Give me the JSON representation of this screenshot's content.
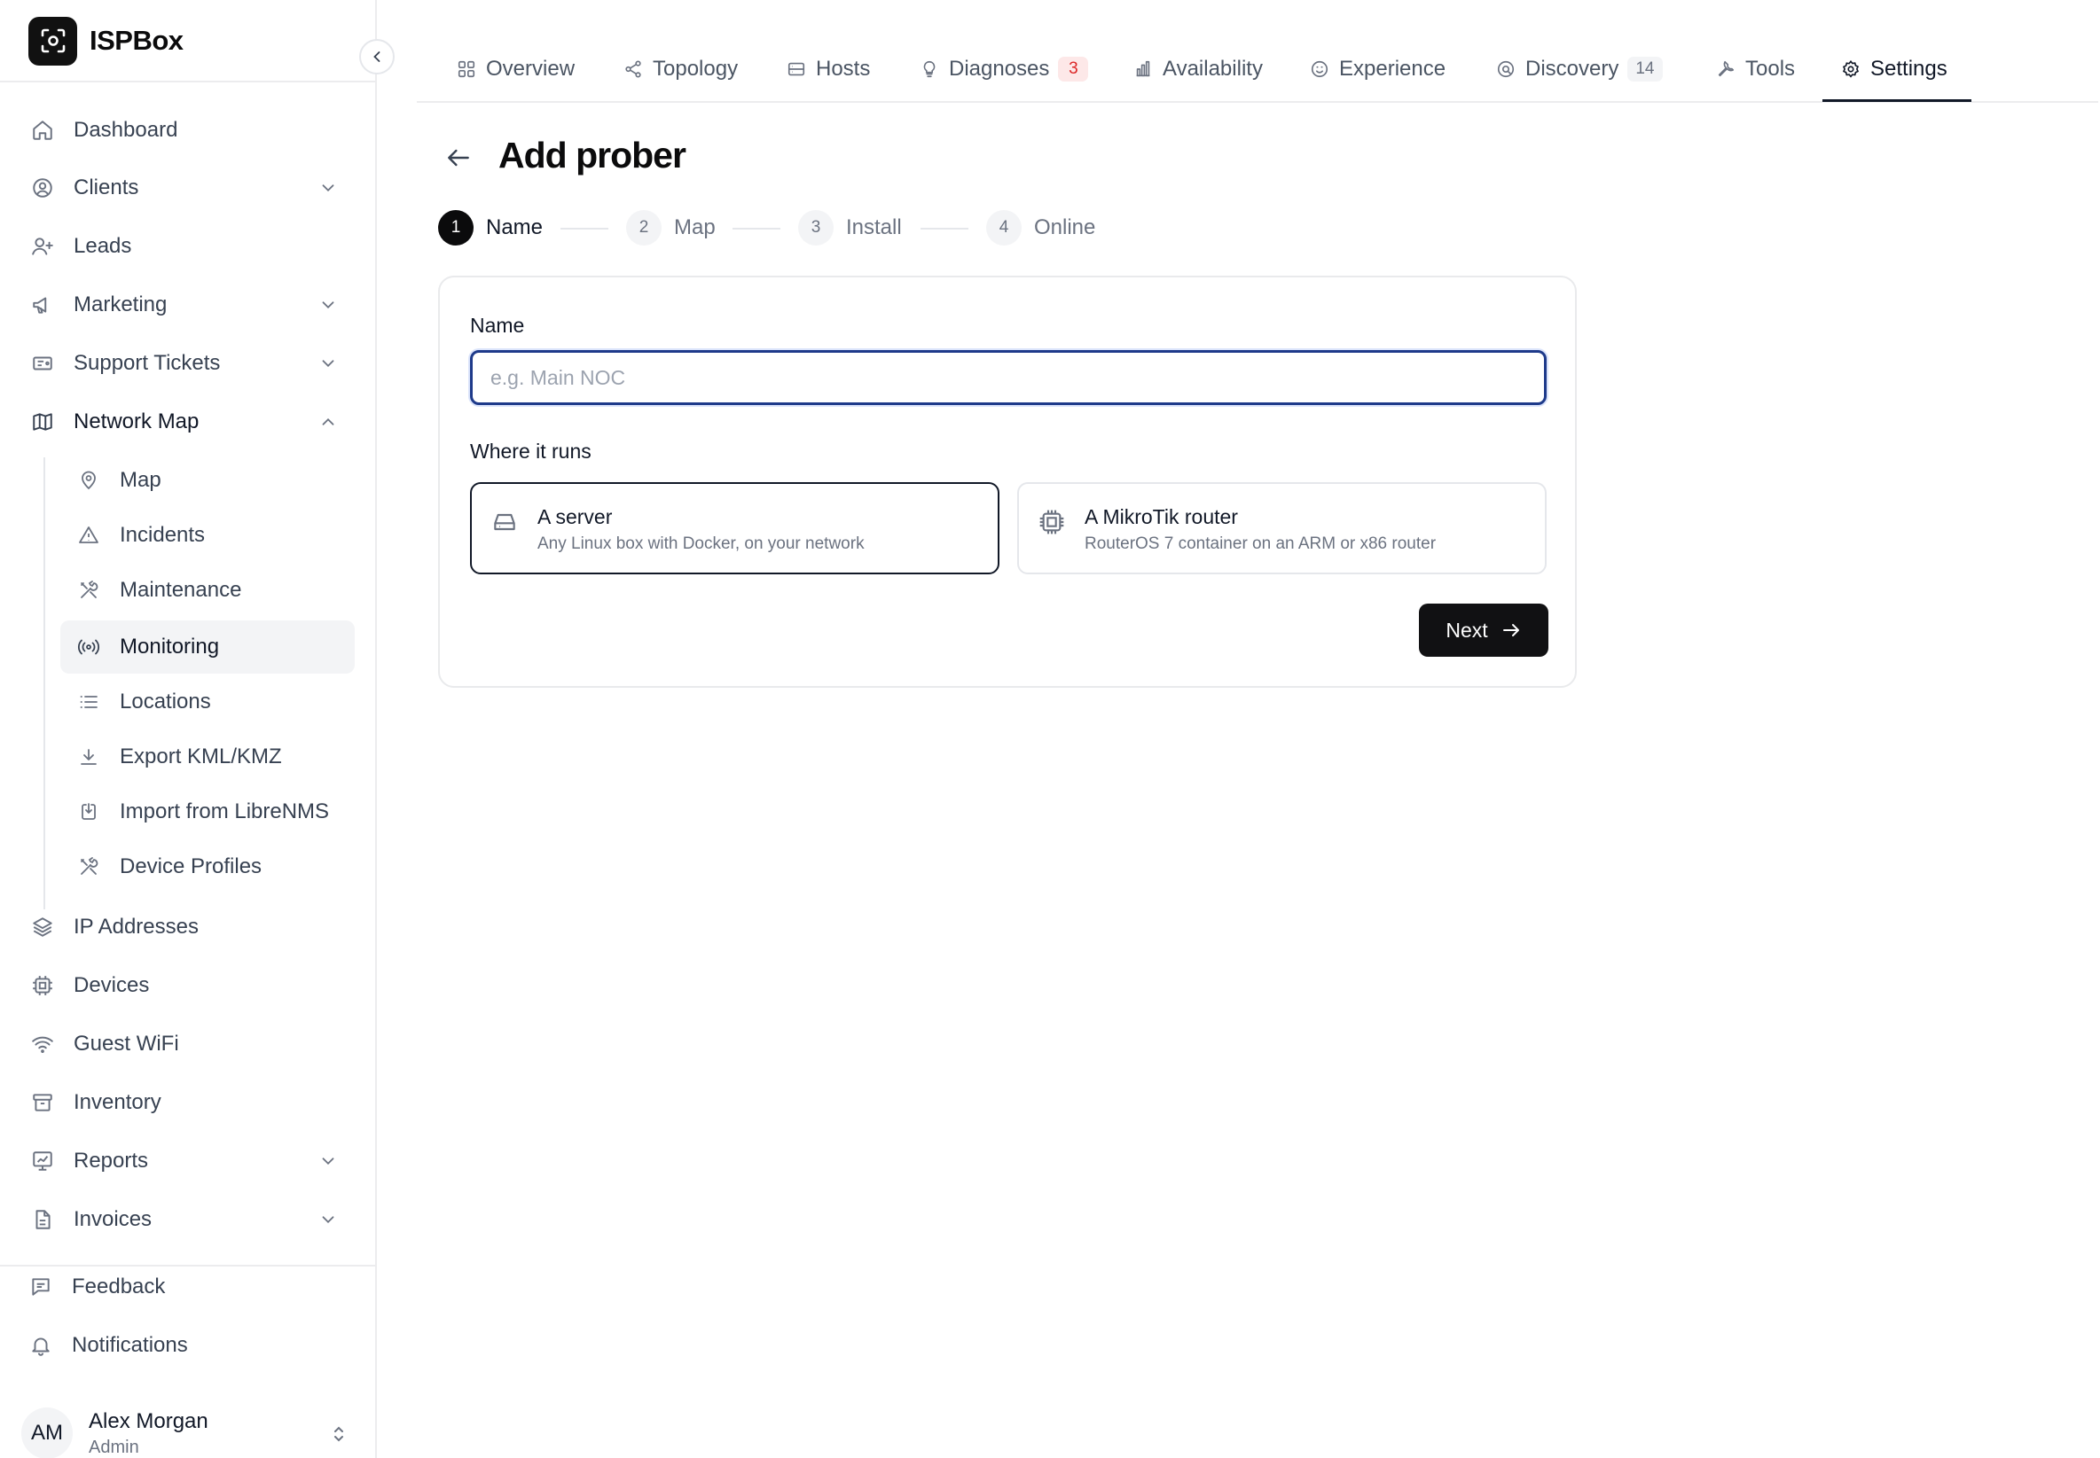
{
  "app": {
    "name": "ISPBox"
  },
  "sidebar": {
    "items": [
      {
        "label": "Dashboard",
        "icon": "home-icon"
      },
      {
        "label": "Clients",
        "icon": "user-circle-icon",
        "expandable": true,
        "expanded": false
      },
      {
        "label": "Leads",
        "icon": "user-plus-icon"
      },
      {
        "label": "Marketing",
        "icon": "megaphone-icon",
        "expandable": true,
        "expanded": false
      },
      {
        "label": "Support Tickets",
        "icon": "ticket-icon",
        "expandable": true,
        "expanded": false
      },
      {
        "label": "Network Map",
        "icon": "map-icon",
        "expandable": true,
        "expanded": true
      }
    ],
    "subitems": [
      {
        "label": "Map",
        "icon": "map-pin-icon"
      },
      {
        "label": "Incidents",
        "icon": "warning-triangle-icon"
      },
      {
        "label": "Maintenance",
        "icon": "tools-icon"
      },
      {
        "label": "Monitoring",
        "icon": "radio-signal-icon",
        "active": true
      },
      {
        "label": "Locations",
        "icon": "list-icon"
      },
      {
        "label": "Export KML/KMZ",
        "icon": "download-icon"
      },
      {
        "label": "Import from LibreNMS",
        "icon": "import-icon"
      },
      {
        "label": "Device Profiles",
        "icon": "tools-icon"
      }
    ],
    "items_after": [
      {
        "label": "IP Addresses",
        "icon": "layers-icon"
      },
      {
        "label": "Devices",
        "icon": "chip-icon"
      },
      {
        "label": "Guest WiFi",
        "icon": "wifi-icon"
      },
      {
        "label": "Inventory",
        "icon": "archive-icon"
      },
      {
        "label": "Reports",
        "icon": "chart-icon",
        "expandable": true,
        "expanded": false
      },
      {
        "label": "Invoices",
        "icon": "file-icon",
        "expandable": true,
        "expanded": false
      }
    ],
    "footer": [
      {
        "label": "Feedback",
        "icon": "message-icon"
      },
      {
        "label": "Notifications",
        "icon": "bell-icon"
      }
    ],
    "user": {
      "initials": "AM",
      "name": "Alex Morgan",
      "role": "Admin"
    }
  },
  "tabs": [
    {
      "label": "Overview",
      "icon": "grid-icon"
    },
    {
      "label": "Topology",
      "icon": "share-icon"
    },
    {
      "label": "Hosts",
      "icon": "server-icon"
    },
    {
      "label": "Diagnoses",
      "icon": "lightbulb-icon",
      "badge": "3",
      "badge_color": "#dc2626"
    },
    {
      "label": "Availability",
      "icon": "bar-chart-icon"
    },
    {
      "label": "Experience",
      "icon": "smile-icon"
    },
    {
      "label": "Discovery",
      "icon": "scan-icon",
      "badge": "14",
      "badge_color": "#6b7280"
    },
    {
      "label": "Tools",
      "icon": "wrench-icon"
    },
    {
      "label": "Settings",
      "icon": "gear-icon",
      "active": true
    }
  ],
  "page": {
    "title": "Add prober"
  },
  "stepper": [
    {
      "number": "1",
      "label": "Name",
      "state": "current"
    },
    {
      "number": "2",
      "label": "Map",
      "state": "todo"
    },
    {
      "number": "3",
      "label": "Install",
      "state": "todo"
    },
    {
      "number": "4",
      "label": "Online",
      "state": "todo"
    }
  ],
  "form": {
    "name_label": "Name",
    "name_value": "",
    "name_placeholder": "e.g. Main NOC",
    "runs_label": "Where it runs",
    "options": [
      {
        "title": "A server",
        "description": "Any Linux box with Docker, on your network",
        "icon": "hard-drive-icon",
        "selected": true
      },
      {
        "title": "A MikroTik router",
        "description": "RouterOS 7 container on an ARM or x86 router",
        "icon": "cpu-chip-icon",
        "selected": false
      }
    ],
    "next_label": "Next"
  },
  "colors": {
    "primary": "#111113",
    "input_focus": "#1e3a8a",
    "badge_red": "#dc2626",
    "muted": "#6b7280"
  }
}
